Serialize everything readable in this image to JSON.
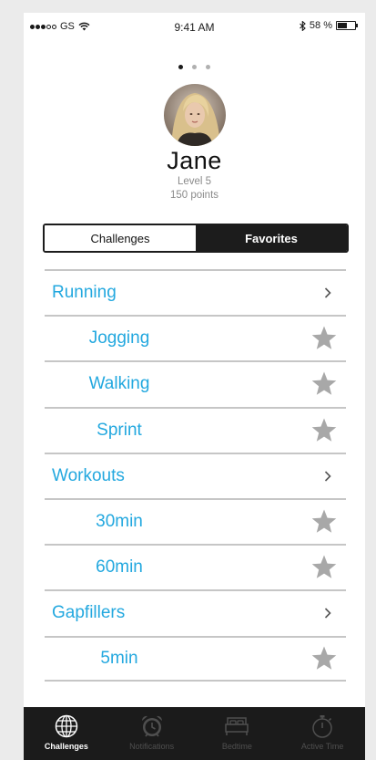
{
  "status_bar": {
    "carrier": "GS",
    "time": "9:41 AM",
    "battery_percent": "58 %",
    "battery_level": 0.58,
    "signal_bars_filled": 3,
    "signal_bars_total": 5
  },
  "pager": {
    "count": 3,
    "active_index": 0
  },
  "profile": {
    "name": "Jane",
    "level": "Level 5",
    "points": "150 points"
  },
  "segment": {
    "challenges_label": "Challenges",
    "favorites_label": "Favorites",
    "selected": "Challenges"
  },
  "list": [
    {
      "type": "category",
      "label": "Running"
    },
    {
      "type": "item",
      "label": "Jogging"
    },
    {
      "type": "item",
      "label": "Walking"
    },
    {
      "type": "item",
      "label": "Sprint"
    },
    {
      "type": "category",
      "label": "Workouts"
    },
    {
      "type": "item",
      "label": "30min"
    },
    {
      "type": "item",
      "label": "60min"
    },
    {
      "type": "category",
      "label": "Gapfillers"
    },
    {
      "type": "item",
      "label": "5min"
    }
  ],
  "tabbar": {
    "challenges": "Challenges",
    "notifications": "Notifications",
    "bedtime": "Bedtime",
    "active_time": "Active Time",
    "active": "Challenges"
  },
  "colors": {
    "accent": "#23a8df",
    "dark": "#1b1b1b",
    "star": "#a8a8a8",
    "divider": "#c6c6c6"
  }
}
